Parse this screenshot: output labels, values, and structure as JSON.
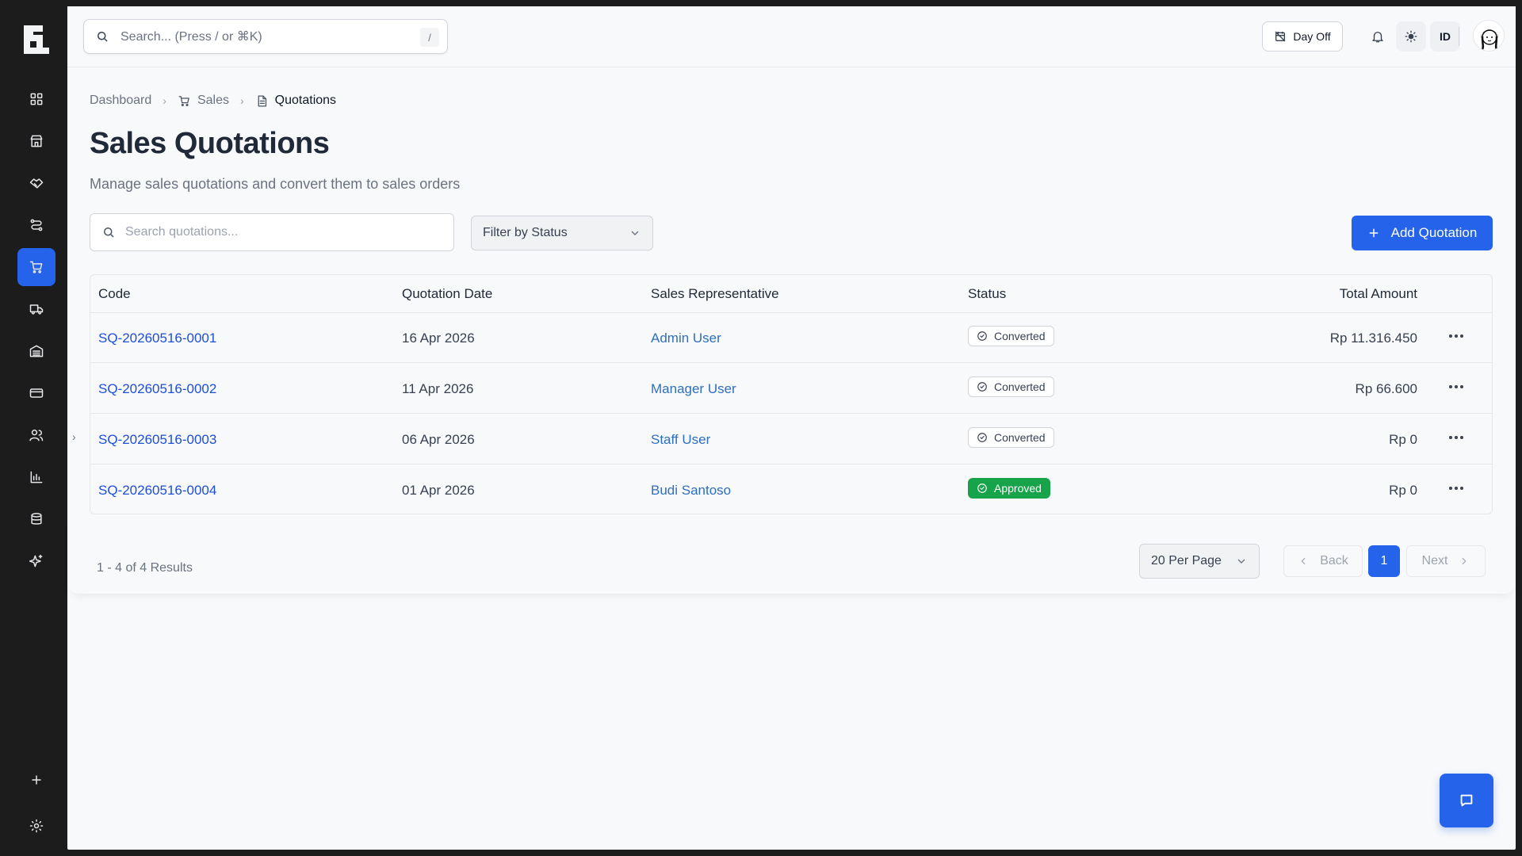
{
  "topbar": {
    "search_placeholder": "Search... (Press / or ⌘K)",
    "search_shortcut": "/",
    "day_off_label": "Day Off",
    "language_label": "ID"
  },
  "breadcrumb": {
    "items": [
      "Dashboard",
      "Sales",
      "Quotations"
    ]
  },
  "page": {
    "title": "Sales Quotations",
    "subtitle": "Manage sales quotations and convert them to sales orders"
  },
  "toolbar": {
    "search_placeholder": "Search quotations...",
    "status_filter_label": "Filter by Status",
    "add_button_label": "Add Quotation"
  },
  "table": {
    "columns": [
      "Code",
      "Quotation Date",
      "Sales Representative",
      "Status",
      "Total Amount"
    ],
    "rows": [
      {
        "code": "SQ-20260516-0001",
        "date": "16 Apr 2026",
        "rep": "Admin User",
        "status": "Converted",
        "total": "Rp 11.316.450"
      },
      {
        "code": "SQ-20260516-0002",
        "date": "11 Apr 2026",
        "rep": "Manager User",
        "status": "Converted",
        "total": "Rp 66.600"
      },
      {
        "code": "SQ-20260516-0003",
        "date": "06 Apr 2026",
        "rep": "Staff User",
        "status": "Converted",
        "total": "Rp 0"
      },
      {
        "code": "SQ-20260516-0004",
        "date": "01 Apr 2026",
        "rep": "Budi Santoso",
        "status": "Approved",
        "total": "Rp 0"
      }
    ]
  },
  "pagination": {
    "results_text": "1 - 4 of 4 Results",
    "per_page_label": "20 Per Page",
    "back_label": "Back",
    "next_label": "Next",
    "current_page": "1"
  },
  "colors": {
    "primary": "#2563eb",
    "approved": "#16a34a",
    "sidebar_bg": "#1c1c1c",
    "link": "#1d4ed8"
  },
  "sidebar": {
    "icons": [
      "dashboard-icon",
      "store-icon",
      "handshake-icon",
      "routes-icon",
      "cart-icon",
      "truck-icon",
      "warehouse-icon",
      "credit-card-icon",
      "users-icon",
      "chart-icon",
      "database-icon",
      "sparkles-icon",
      "plus-icon",
      "gear-icon"
    ],
    "active": "cart-icon"
  }
}
